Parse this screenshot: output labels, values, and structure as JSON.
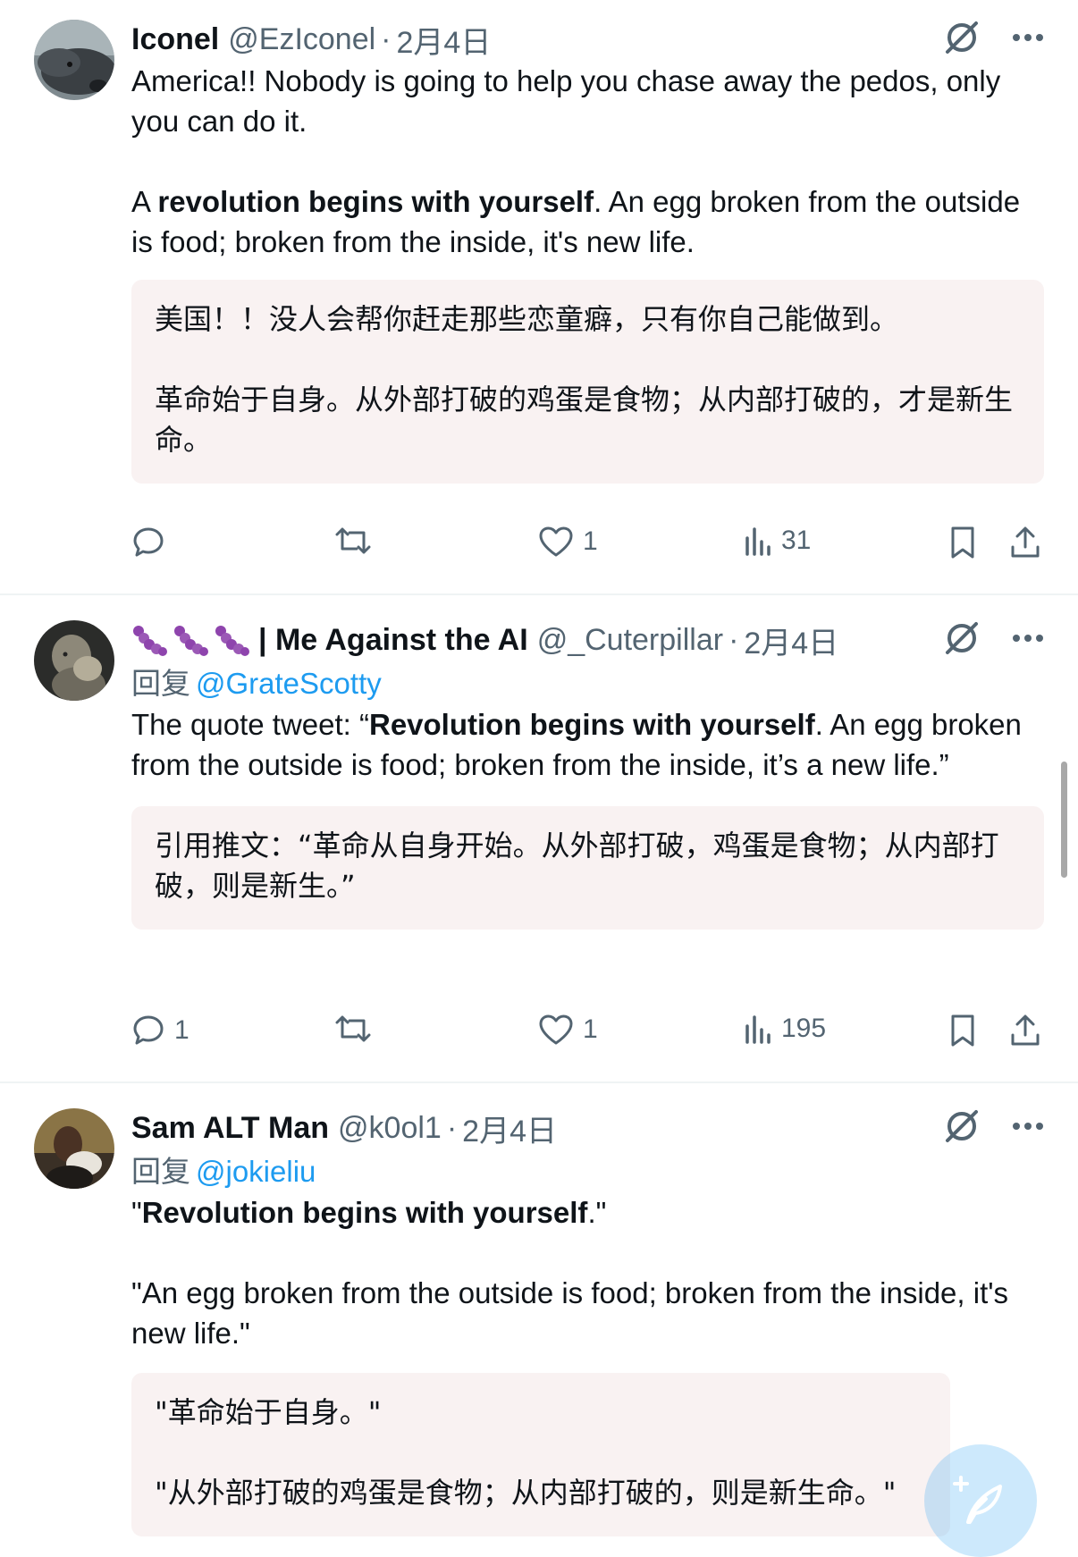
{
  "tweets": [
    {
      "name": "Iconel",
      "handle": "@EzIconel",
      "date": "2月4日",
      "text_p1": "America!! Nobody is going to help you chase away the pedos, only you can do it.",
      "text_p2_pre": "A ",
      "text_p2_bold": "revolution begins with yourself",
      "text_p2_post": ". An egg broken from the outside is food; broken from the inside, it's new life.",
      "translation_p1": "美国！！没人会帮你赶走那些恋童癖，只有你自己能做到。",
      "translation_p2": "革命始于自身。从外部打破的鸡蛋是食物；从内部打破的，才是新生命。",
      "replies": "",
      "likes": "1",
      "views": "31"
    },
    {
      "name": "| Me Against the AI",
      "handle": "@_Cuterpillar",
      "date": "2月4日",
      "reply_label": "回复",
      "reply_mention": "@GrateScotty",
      "text_pre": "The quote tweet: “",
      "text_bold": "Revolution begins with yourself",
      "text_post": ". An egg broken from the outside is food; broken from the inside, it’s a new life.”",
      "translation_p1": "引用推文：“革命从自身开始。从外部打破，鸡蛋是食物；从内部打破，则是新生。”",
      "replies": "1",
      "likes": "1",
      "views": "195"
    },
    {
      "name": "Sam ALT Man",
      "handle": "@k0ol1",
      "date": "2月4日",
      "reply_label": "回复",
      "reply_mention": "@jokieliu",
      "text_p1_pre": "\"",
      "text_p1_bold": "Revolution begins with yourself",
      "text_p1_post": ".\"",
      "text_p2": "\"An egg broken from the outside is food; broken from the inside, it's new life.\"",
      "translation_p1": "\"革命始于自身。\"",
      "translation_p2": "\"从外部打破的鸡蛋是食物；从内部打破的，则是新生命。\""
    }
  ],
  "separator_dot": "·",
  "icons": {
    "grok": "grok-icon",
    "more": "more-dots-icon",
    "reply": "reply-icon",
    "retweet": "retweet-icon",
    "like": "heart-icon",
    "views": "views-chart-icon",
    "bookmark": "bookmark-icon",
    "share": "share-icon",
    "compose": "compose-icon"
  },
  "colors": {
    "text": "#0f1419",
    "secondary": "#536471",
    "link": "#1d9bf0",
    "translation_bg": "#f9f2f2"
  }
}
